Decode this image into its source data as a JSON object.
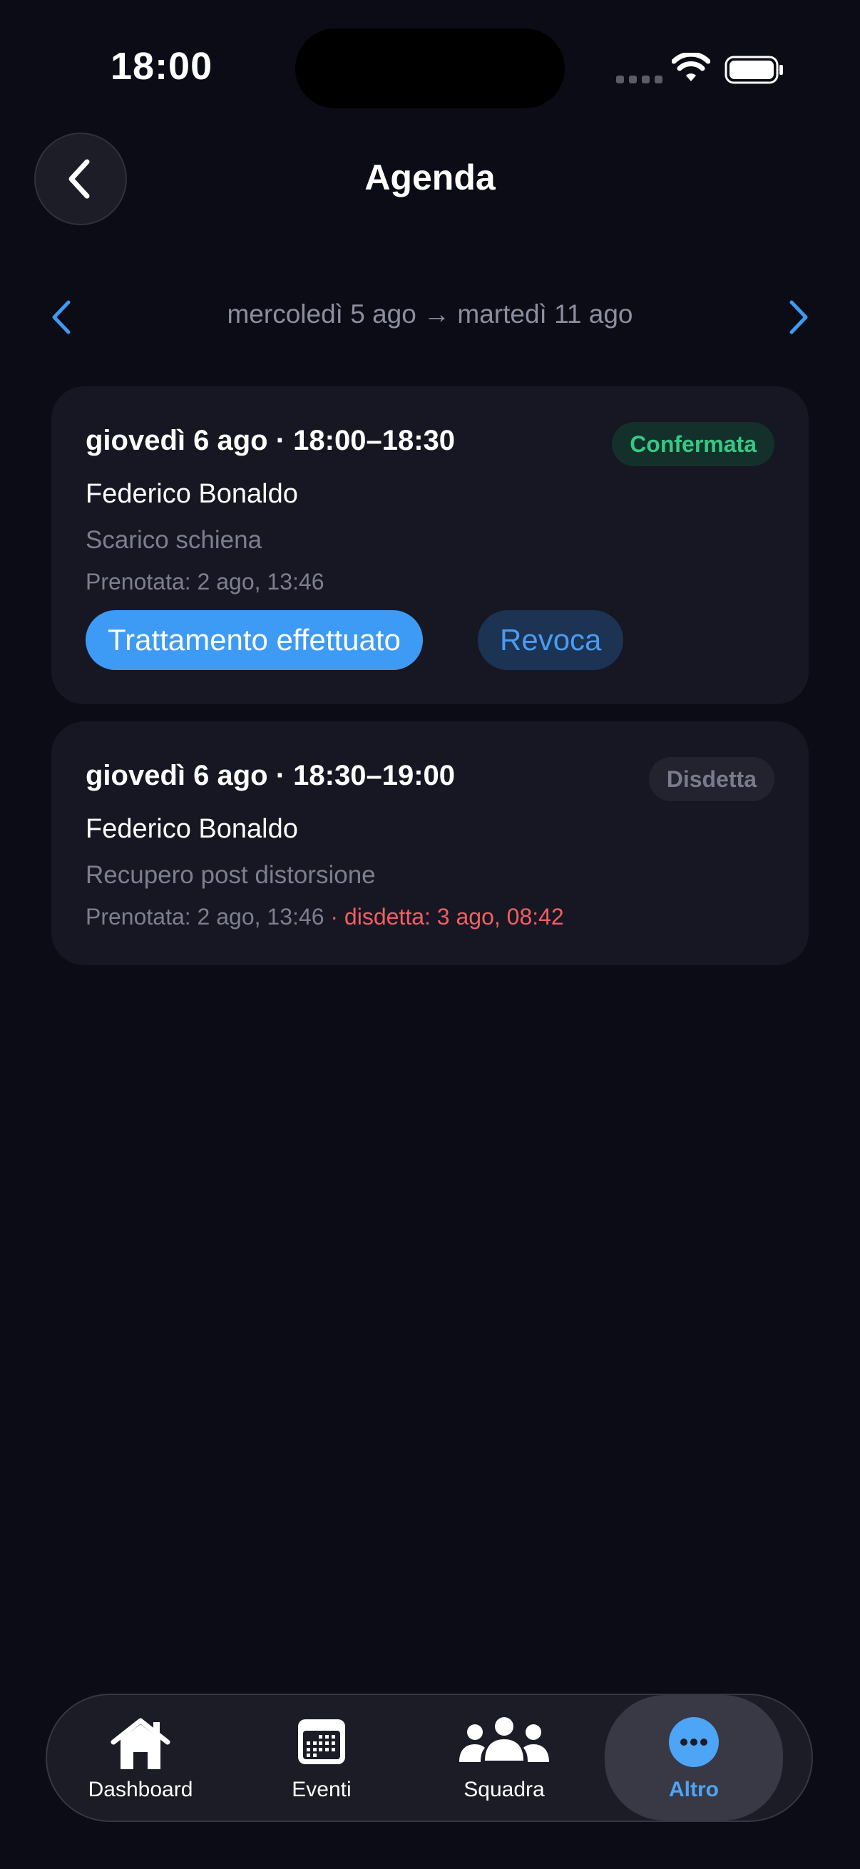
{
  "status_bar": {
    "time": "18:00"
  },
  "header": {
    "title": "Agenda"
  },
  "range_nav": {
    "label": "mercoledì 5 ago → martedì 11 ago"
  },
  "appointments": [
    {
      "datetime": "giovedì 6 ago · 18:00–18:30",
      "status": "Confermata",
      "patient": "Federico Bonaldo",
      "description": "Scarico schiena",
      "booked": "Prenotata: 2 ago, 13:46",
      "actions": {
        "primary": "Trattamento effettuato",
        "secondary": "Revoca"
      }
    },
    {
      "datetime": "giovedì 6 ago · 18:30–19:00",
      "status": "Disdetta",
      "patient": "Federico Bonaldo",
      "description": "Recupero post distorsione",
      "booked": "Prenotata: 2 ago, 13:46",
      "cancelled": "· disdetta: 3 ago, 08:42"
    }
  ],
  "tabbar": {
    "items": [
      {
        "label": "Dashboard",
        "icon": "house-icon"
      },
      {
        "label": "Eventi",
        "icon": "calendar-icon"
      },
      {
        "label": "Squadra",
        "icon": "people-icon"
      },
      {
        "label": "Altro",
        "icon": "ellipsis-circle-icon",
        "active": true
      }
    ]
  },
  "colors": {
    "background": "#0b0c15",
    "card": "#161723",
    "accent": "#3d9bf5",
    "confirmed": "#34c985",
    "cancelled": "#f15f63"
  }
}
